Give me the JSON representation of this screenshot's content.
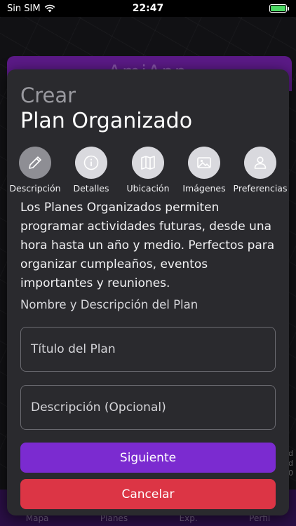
{
  "status_bar": {
    "carrier": "Sin SIM",
    "time": "22:47"
  },
  "background": {
    "logo_text": "AmiApp",
    "right_text": [
      "d",
      "d",
      "0"
    ],
    "tabbar": [
      "Mapa",
      "Planes",
      "Exp.",
      "Perfil"
    ]
  },
  "modal": {
    "title_small": "Crear",
    "title_big": "Plan Organizado",
    "steps": [
      {
        "label": "Descripción",
        "icon": "pencil-icon",
        "active": true
      },
      {
        "label": "Detalles",
        "icon": "info-icon",
        "active": false
      },
      {
        "label": "Ubicación",
        "icon": "map-icon",
        "active": false
      },
      {
        "label": "Imágenes",
        "icon": "image-icon",
        "active": false
      },
      {
        "label": "Preferencias",
        "icon": "user-icon",
        "active": false
      }
    ],
    "intro": "Los Planes Organizados permiten programar actividades futuras, desde una hora hasta un año y medio. Perfectos para organizar cumpleaños, eventos importantes y reuniones.",
    "section_label": "Nombre y Descripción del Plan",
    "title_field_placeholder": "Título del Plan",
    "description_field_placeholder": "Descripción (Opcional)",
    "next_button": "Siguiente",
    "cancel_button": "Cancelar"
  },
  "colors": {
    "accent": "#7b2bd0",
    "danger": "#dc3545",
    "modal_bg": "#2a2a2e"
  }
}
